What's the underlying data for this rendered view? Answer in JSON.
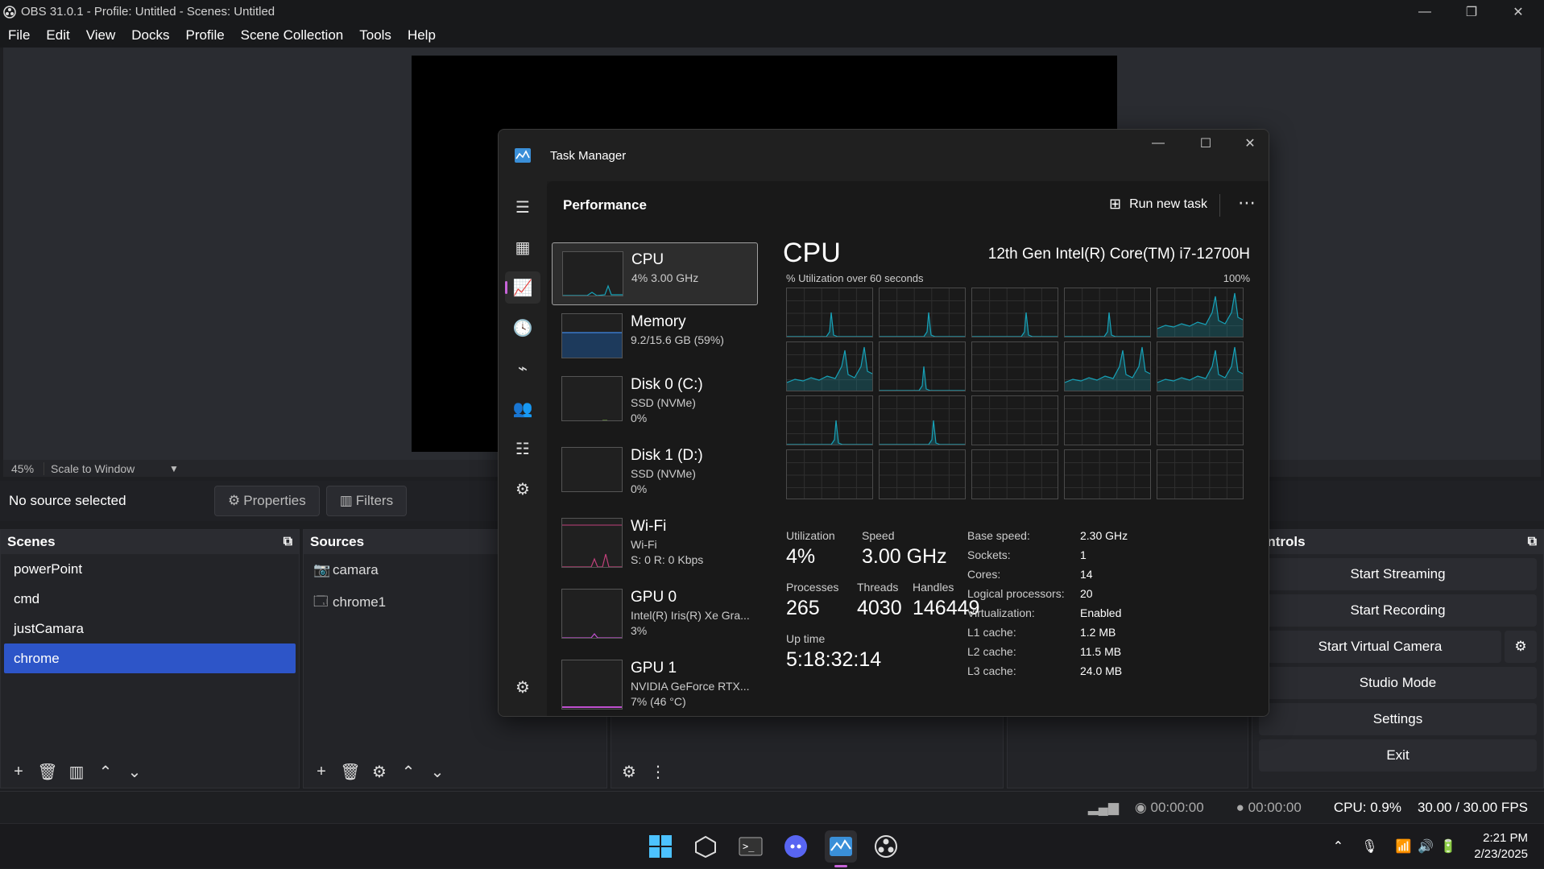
{
  "obs": {
    "window_title": "OBS 31.0.1 - Profile: Untitled - Scenes: Untitled",
    "menu": [
      "File",
      "Edit",
      "View",
      "Docks",
      "Profile",
      "Scene Collection",
      "Tools",
      "Help"
    ],
    "preview": {
      "zoom": "45%",
      "scale_mode": "Scale to Window"
    },
    "source_bar": {
      "status": "No source selected",
      "properties_label": "Properties",
      "filters_label": "Filters"
    },
    "scenes": {
      "title": "Scenes",
      "items": [
        "powerPoint",
        "cmd",
        "justCamara",
        "chrome"
      ],
      "selected": "chrome"
    },
    "sources": {
      "title": "Sources",
      "items": [
        "camara",
        "chrome1"
      ]
    },
    "controls": {
      "title": "ontrols",
      "start_streaming": "Start Streaming",
      "start_recording": "Start Recording",
      "start_virtual_camera": "Start Virtual Camera",
      "studio_mode": "Studio Mode",
      "settings": "Settings",
      "exit": "Exit"
    },
    "status": {
      "stream_time": "00:00:00",
      "record_time": "00:00:00",
      "cpu": "CPU: 0.9%",
      "fps": "30.00 / 30.00 FPS"
    }
  },
  "taskbar": {
    "time": "2:21 PM",
    "date": "2/23/2025"
  },
  "task_manager": {
    "title": "Task Manager",
    "page_title": "Performance",
    "run_new_task": "Run new task",
    "resources": [
      {
        "name": "CPU",
        "line1": "4% 3.00 GHz",
        "line2": ""
      },
      {
        "name": "Memory",
        "line1": "9.2/15.6 GB (59%)",
        "line2": ""
      },
      {
        "name": "Disk 0 (C:)",
        "line1": "SSD (NVMe)",
        "line2": "0%"
      },
      {
        "name": "Disk 1 (D:)",
        "line1": "SSD (NVMe)",
        "line2": "0%"
      },
      {
        "name": "Wi-Fi",
        "line1": "Wi-Fi",
        "line2": "S: 0 R: 0 Kbps"
      },
      {
        "name": "GPU 0",
        "line1": "Intel(R) Iris(R) Xe Gra...",
        "line2": "3%"
      },
      {
        "name": "GPU 1",
        "line1": "NVIDIA GeForce RTX...",
        "line2": "7% (46 °C)"
      }
    ],
    "cpu": {
      "heading": "CPU",
      "model": "12th Gen Intel(R) Core(TM) i7-12700H",
      "util_label": "% Utilization over 60 seconds",
      "util_max": "100%",
      "utilization_label": "Utilization",
      "utilization": "4%",
      "speed_label": "Speed",
      "speed": "3.00 GHz",
      "processes_label": "Processes",
      "processes": "265",
      "threads_label": "Threads",
      "threads": "4030",
      "handles_label": "Handles",
      "handles": "146449",
      "uptime_label": "Up time",
      "uptime": "5:18:32:14",
      "specs": [
        {
          "label": "Base speed:",
          "value": "2.30 GHz"
        },
        {
          "label": "Sockets:",
          "value": "1"
        },
        {
          "label": "Cores:",
          "value": "14"
        },
        {
          "label": "Logical processors:",
          "value": "20"
        },
        {
          "label": "Virtualization:",
          "value": "Enabled"
        },
        {
          "label": "L1 cache:",
          "value": "1.2 MB"
        },
        {
          "label": "L2 cache:",
          "value": "11.5 MB"
        },
        {
          "label": "L3 cache:",
          "value": "24.0 MB"
        }
      ]
    }
  },
  "colors": {
    "accent": "#2d55c8",
    "cpu_graph": "#17a2b8",
    "memory_graph": "#3a78c8",
    "wifi_graph": "#c0407a",
    "gpu_graph": "#c050d0"
  }
}
